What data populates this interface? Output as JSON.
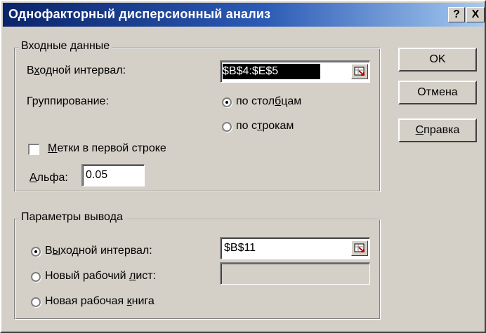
{
  "window": {
    "title": "Однофакторный дисперсионный анализ",
    "help_button": "?",
    "close_button": "X"
  },
  "input_group": {
    "legend": "Входные данные",
    "input_range_label": "Входной интервал:",
    "input_range_value": "$B$4:$E$5",
    "grouping_label": "Группирование:",
    "by_columns_label": "по столбцам",
    "by_columns_selected": true,
    "by_rows_label": "по строкам",
    "by_rows_selected": false,
    "labels_first_row_label": "Метки в первой строке",
    "labels_first_row_checked": false,
    "alpha_label": "Альфа:",
    "alpha_value": "0.05"
  },
  "output_group": {
    "legend": "Параметры вывода",
    "output_range_label": "Выходной интервал:",
    "output_range_selected": true,
    "output_range_value": "$B$11",
    "new_sheet_label": "Новый рабочий лист:",
    "new_sheet_value": "",
    "new_workbook_label": "Новая рабочая книга"
  },
  "buttons": {
    "ok": "OK",
    "cancel": "Отмена",
    "help": "Справка"
  }
}
